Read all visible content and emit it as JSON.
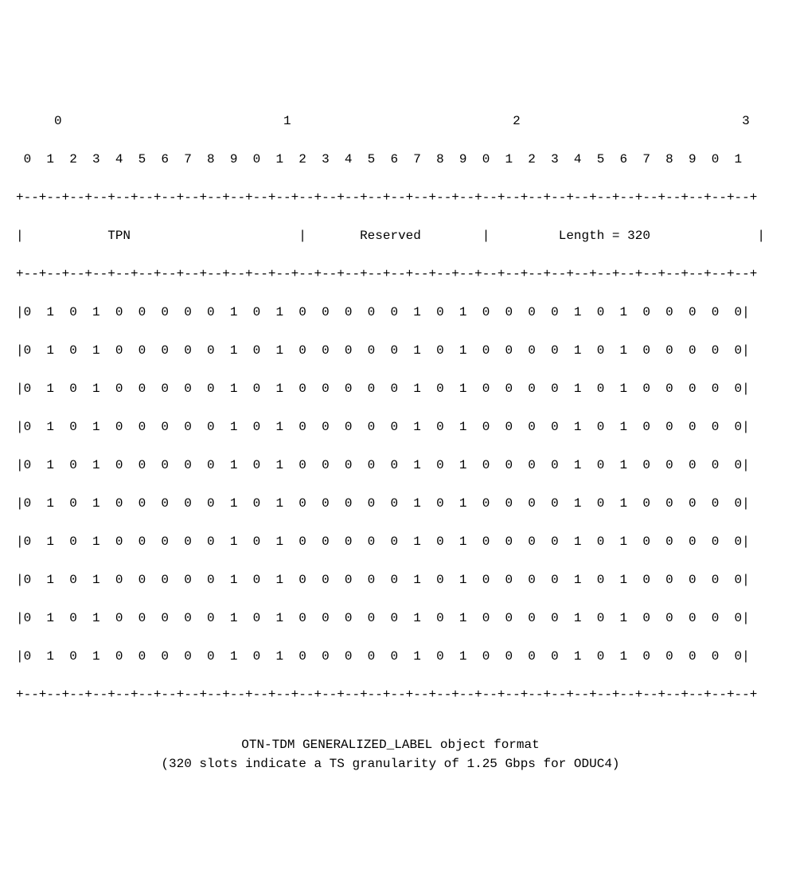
{
  "ruler": {
    "major": "     0                             1                             2                             3",
    "minor": " 0  1  2  3  4  5  6  7  8  9  0  1  2  3  4  5  6  7  8  9  0  1  2  3  4  5  6  7  8  9  0  1"
  },
  "border": "+--+--+--+--+--+--+--+--+--+--+--+--+--+--+--+--+--+--+--+--+--+--+--+--+--+--+--+--+--+--+--+--+",
  "header": {
    "tpn": "TPN",
    "reserved": "Reserved",
    "length": "Length = 320",
    "row": "|           TPN                      |       Reserved        |         Length = 320              |"
  },
  "data_rows": [
    "|0  1  0  1  0  0  0  0  0  1  0  1  0  0  0  0  0  1  0  1  0  0  0  0  1  0  1  0  0  0  0  0|",
    "|0  1  0  1  0  0  0  0  0  1  0  1  0  0  0  0  0  1  0  1  0  0  0  0  1  0  1  0  0  0  0  0|",
    "|0  1  0  1  0  0  0  0  0  1  0  1  0  0  0  0  0  1  0  1  0  0  0  0  1  0  1  0  0  0  0  0|",
    "|0  1  0  1  0  0  0  0  0  1  0  1  0  0  0  0  0  1  0  1  0  0  0  0  1  0  1  0  0  0  0  0|",
    "|0  1  0  1  0  0  0  0  0  1  0  1  0  0  0  0  0  1  0  1  0  0  0  0  1  0  1  0  0  0  0  0|",
    "|0  1  0  1  0  0  0  0  0  1  0  1  0  0  0  0  0  1  0  1  0  0  0  0  1  0  1  0  0  0  0  0|",
    "|0  1  0  1  0  0  0  0  0  1  0  1  0  0  0  0  0  1  0  1  0  0  0  0  1  0  1  0  0  0  0  0|",
    "|0  1  0  1  0  0  0  0  0  1  0  1  0  0  0  0  0  1  0  1  0  0  0  0  1  0  1  0  0  0  0  0|",
    "|0  1  0  1  0  0  0  0  0  1  0  1  0  0  0  0  0  1  0  1  0  0  0  0  1  0  1  0  0  0  0  0|",
    "|0  1  0  1  0  0  0  0  0  1  0  1  0  0  0  0  0  1  0  1  0  0  0  0  1  0  1  0  0  0  0  0|"
  ],
  "caption": {
    "line1": "OTN-TDM GENERALIZED_LABEL object format",
    "line2": "(320 slots indicate a TS granularity of 1.25 Gbps for ODUC4)"
  },
  "chart_data": {
    "type": "table",
    "title": "OTN-TDM GENERALIZED_LABEL object format",
    "subtitle": "(320 slots indicate a TS granularity of 1.25 Gbps for ODUC4)",
    "bit_width": 32,
    "fields": [
      {
        "name": "TPN",
        "bits_start": 0,
        "bits_end": 11
      },
      {
        "name": "Reserved",
        "bits_start": 12,
        "bits_end": 19
      },
      {
        "name": "Length",
        "value": 320,
        "bits_start": 20,
        "bits_end": 31
      }
    ],
    "payload_rows": 10,
    "total_slots": 320,
    "ts_granularity_gbps": 1.25,
    "odu_type": "ODUC4",
    "bit_pattern": "01010000010100000101000010100000"
  }
}
